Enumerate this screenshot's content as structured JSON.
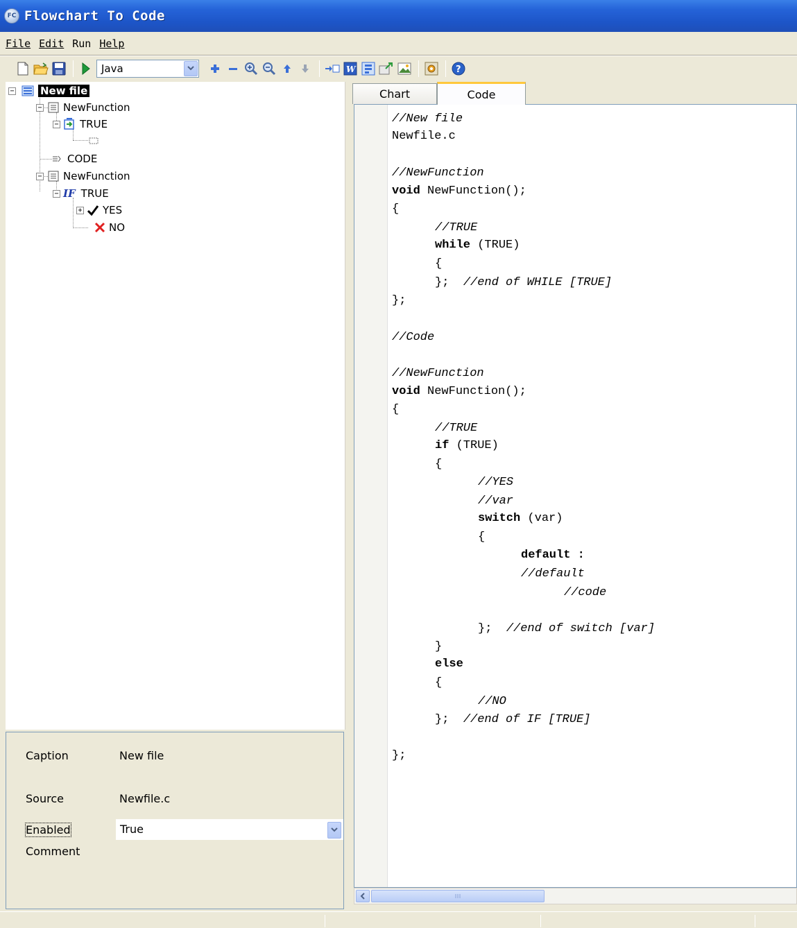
{
  "window": {
    "title": "Flowchart To Code"
  },
  "menu": {
    "file": "File",
    "edit": "Edit",
    "run": "Run",
    "help": "Help"
  },
  "toolbar": {
    "language": "Java"
  },
  "tree": {
    "root": "New file",
    "function1": "NewFunction",
    "while_node": "TRUE",
    "code_node": "CODE",
    "function2": "NewFunction",
    "if_node": "TRUE",
    "yes_node": "YES",
    "no_node": "NO"
  },
  "props": {
    "caption_label": "Caption",
    "caption_value": "New file",
    "source_label": "Source",
    "source_value": "Newfile.c",
    "enabled_label": "Enabled",
    "enabled_value": "True",
    "comment_label": "Comment"
  },
  "tabs": {
    "chart": "Chart",
    "code": "Code"
  },
  "code": {
    "l1": "//New file",
    "l2": "Newfile.c",
    "l3": "//NewFunction",
    "l4_kw": "void",
    "l4_rest": " NewFunction();",
    "l5": "{",
    "l6": "//TRUE",
    "l7_kw": "while",
    "l7_rest": " (TRUE)",
    "l8": "{",
    "l9_a": "};  ",
    "l9_b": "//end of WHILE [TRUE]",
    "l10": "};",
    "l11": "//Code",
    "l12": "//NewFunction",
    "l13_kw": "void",
    "l13_rest": " NewFunction();",
    "l14": "{",
    "l15": "//TRUE",
    "l16_kw": "if",
    "l16_rest": " (TRUE)",
    "l17": "{",
    "l18": "//YES",
    "l19": "//var",
    "l20_kw": "switch",
    "l20_rest": " (var)",
    "l21": "{",
    "l22": "default :",
    "l23": "//default",
    "l24": "//code",
    "l25_a": "};  ",
    "l25_b": "//end of switch [var]",
    "l26": "}",
    "l27": "else",
    "l28": "{",
    "l29": "//NO",
    "l30_a": "};  ",
    "l30_b": "//end of IF [TRUE]",
    "l31": "};"
  }
}
